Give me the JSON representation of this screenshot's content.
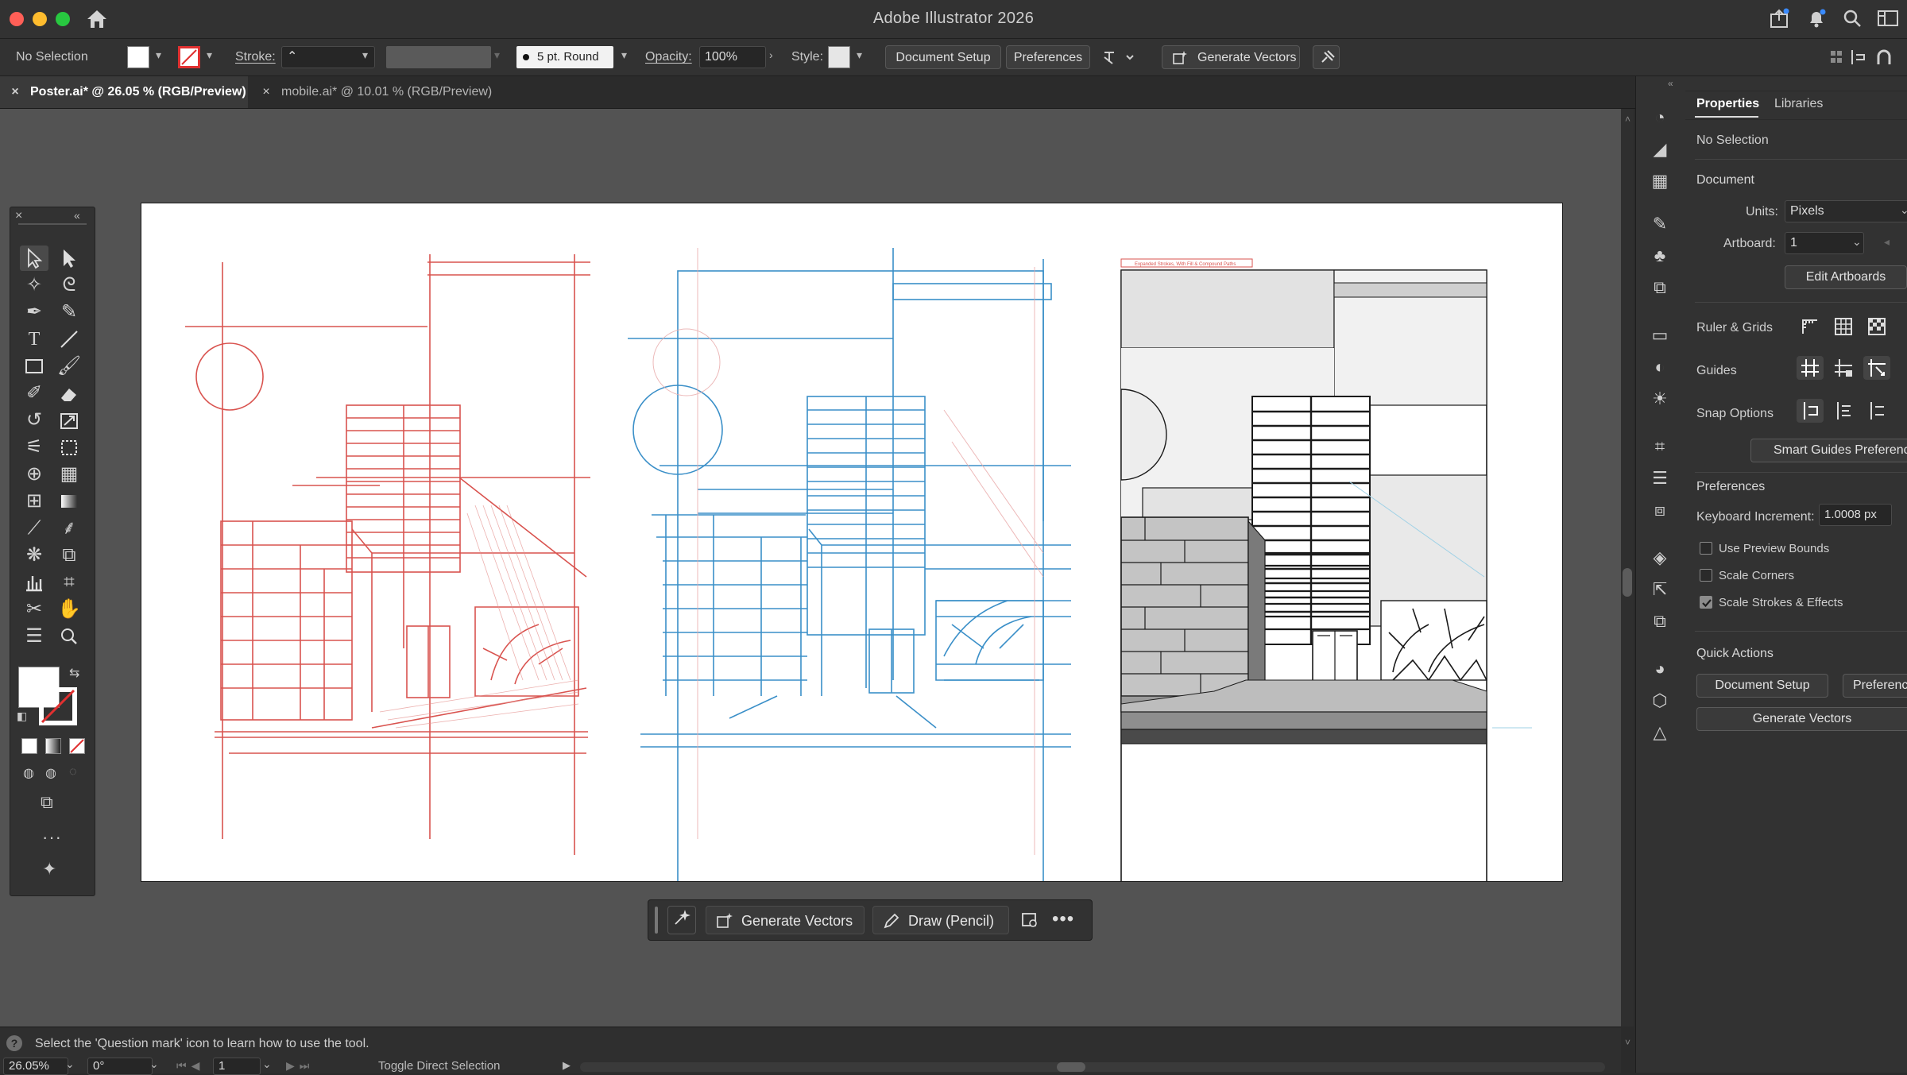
{
  "app": {
    "title": "Adobe Illustrator 2026"
  },
  "control_bar": {
    "selection": "No Selection",
    "stroke_label": "Stroke:",
    "brush_value": "5 pt. Round",
    "opacity_label": "Opacity:",
    "opacity_value": "100%",
    "style_label": "Style:",
    "document_setup": "Document Setup",
    "preferences": "Preferences",
    "generate_vectors": "Generate Vectors"
  },
  "tabs": [
    {
      "label": "Poster.ai* @ 26.05 % (RGB/Preview)",
      "active": true
    },
    {
      "label": "mobile.ai* @ 10.01 % (RGB/Preview)",
      "active": false
    }
  ],
  "artboard": {
    "panel3_caption": "Expanded Strokes, With Fill & Compound Paths",
    "colors": {
      "sketch_red": "#d9534f",
      "sketch_blue": "#3a8fc8",
      "ink": "#1a1a1a"
    }
  },
  "contextual_bar": {
    "generate_vectors": "Generate Vectors",
    "draw_pencil": "Draw (Pencil)"
  },
  "status_bar": {
    "hint": "Select the 'Question mark' icon to learn how to use the tool.",
    "zoom": "26.05%",
    "rotation": "0°",
    "artboard_number": "1",
    "tool_name": "Toggle Direct Selection"
  },
  "properties_panel": {
    "tabs": [
      "Properties",
      "Libraries"
    ],
    "selection": "No Selection",
    "document_heading": "Document",
    "units_label": "Units:",
    "units_value": "Pixels",
    "artboard_label": "Artboard:",
    "artboard_value": "1",
    "edit_artboards": "Edit Artboards",
    "ruler_grids": "Ruler & Grids",
    "guides": "Guides",
    "snap_options": "Snap Options",
    "smart_guides_prefs": "Smart Guides Preferences",
    "preferences_heading": "Preferences",
    "keyboard_increment_label": "Keyboard Increment:",
    "keyboard_increment_value": "1.0008 px",
    "checkboxes": [
      {
        "label": "Use Preview Bounds",
        "checked": false
      },
      {
        "label": "Scale Corners",
        "checked": false
      },
      {
        "label": "Scale Strokes & Effects",
        "checked": true
      }
    ],
    "quick_actions_heading": "Quick Actions",
    "qa_document_setup": "Document Setup",
    "qa_preferences": "Preferences",
    "qa_generate_vectors": "Generate Vectors"
  }
}
